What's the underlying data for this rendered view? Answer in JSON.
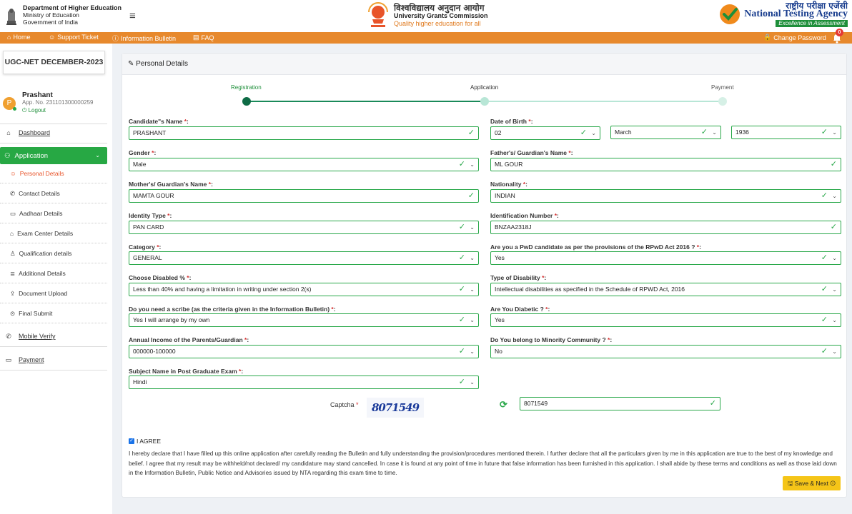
{
  "header": {
    "dept_line1": "Department of Higher Education",
    "dept_line2": "Ministry of Education",
    "dept_line3": "Government of India",
    "ugc_hindi": "विश्वविद्यालय अनुदान आयोग",
    "ugc_english": "University Grants Commission",
    "ugc_tagline": "Quality higher education for all",
    "nta_hindi": "राष्ट्रीय परीक्षा एजेंसी",
    "nta_english": "National Testing Agency",
    "nta_tagline": "Excellence in Assessment"
  },
  "nav": {
    "home": "Home",
    "support": "Support Ticket",
    "info": "Information Bulletin",
    "faq": "FAQ",
    "change_password": "Change Password",
    "notifications": "0"
  },
  "sidebar": {
    "exam": "UGC-NET DECEMBER-2023",
    "user_initial": "P",
    "user_name": "Prashant",
    "app_no": "App. No. 231101300000259",
    "logout": "Logout",
    "dashboard": "Dashboard",
    "application": "Application",
    "sub_items": [
      "Personal Details",
      "Contact Details",
      "Aadhaar Details",
      "Exam Center Details",
      "Qualification details",
      "Additional Details",
      "Document Upload",
      "Final Submit"
    ],
    "mobile_verify": "Mobile Verify",
    "payment": "Payment"
  },
  "card": {
    "title": "Personal Details"
  },
  "steps": {
    "registration": "Registration",
    "application": "Application",
    "payment": "Payment"
  },
  "form": {
    "candidate_name_label": "Candidate\"s Name ",
    "candidate_name": "PRASHANT",
    "dob_label": "Date of Birth ",
    "dob_day": "02",
    "dob_month": "March",
    "dob_year": "1936",
    "gender_label": "Gender ",
    "gender": "Male",
    "father_label": "Father's/ Guardian's Name ",
    "father": "ML GOUR",
    "mother_label": "Mother's/ Guardian's Name ",
    "mother": "MAMTA GOUR",
    "nationality_label": "Nationality ",
    "nationality": "INDIAN",
    "id_type_label": "Identity Type ",
    "id_type": "PAN CARD",
    "id_number_label": "Identification Number ",
    "id_number": "BNZAA2318J",
    "category_label": "Category ",
    "category": "GENERAL",
    "pwd_label": "Are you a PwD candidate as per the provisions of the RPwD Act 2016 ? ",
    "pwd": "Yes",
    "disabled_pct_label": "Choose Disabled % ",
    "disabled_pct": "Less than 40% and having a limitation in writing under section 2(s)",
    "disability_type_label": "Type of Disability ",
    "disability_type": "Intellectual disabilities as specified in the Schedule of RPWD Act, 2016",
    "scribe_label": "Do you need a scribe (as the criteria given in the Information Bulletin) ",
    "scribe": "Yes I will arrange by my own",
    "diabetic_label": "Are You Diabetic ? ",
    "diabetic": "Yes",
    "income_label": "Annual Income of the Parents/Guardian ",
    "income": "000000-100000",
    "minority_label": "Do You belong to Minority Community ? ",
    "minority": "No",
    "subject_label": "Subject Name in Post Graduate Exam ",
    "subject": "Hindi",
    "req_mark": "*",
    "colon": ":"
  },
  "captcha": {
    "label": "Captcha",
    "image_text": "8071549",
    "value": "8071549"
  },
  "agree": {
    "label": "I AGREE",
    "declaration": "I hereby declare that I have filled up this online application after carefully reading the Bulletin and fully understanding the provision/procedures mentioned therein. I further declare that all the particulars given by me in this application are true to the best of my knowledge and belief. I agree that my result may be withheld/not declared/ my candidature may stand cancelled. In case it is found at any point of time in future that false information has been furnished in this application. I shall abide by these terms and conditions as well as those laid down in the Information Bulletin, Public Notice and Advisories issued by NTA regarding this exam time to time."
  },
  "save_button": "Save & Next",
  "colors": {
    "brand_orange": "#e7892d",
    "success_green": "#27a844",
    "active_sub": "#e8542a",
    "save_yellow": "#f5c518"
  }
}
